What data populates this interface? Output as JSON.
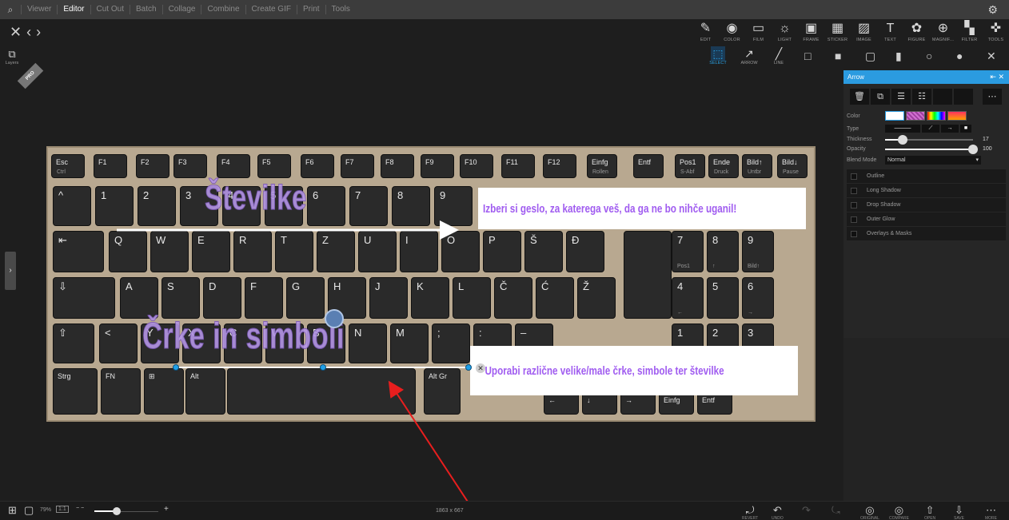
{
  "menu": {
    "items": [
      "Viewer",
      "Editor",
      "Cut Out",
      "Batch",
      "Collage",
      "Combine",
      "Create GIF",
      "Print",
      "Tools"
    ],
    "active": "Editor"
  },
  "nav": {
    "close": "✕",
    "back": "‹",
    "forward": "›"
  },
  "tools": [
    {
      "icon": "edit-icon",
      "glyph": "✎",
      "label": "EDIT"
    },
    {
      "icon": "color-icon",
      "glyph": "◉",
      "label": "COLOR"
    },
    {
      "icon": "film-icon",
      "glyph": "▭",
      "label": "FILM"
    },
    {
      "icon": "light-icon",
      "glyph": "☼",
      "label": "LIGHT"
    },
    {
      "icon": "frame-icon",
      "glyph": "▣",
      "label": "FRAME"
    },
    {
      "icon": "sticker-icon",
      "glyph": "▦",
      "label": "STICKER"
    },
    {
      "icon": "image-icon",
      "glyph": "▨",
      "label": "IMAGE"
    },
    {
      "icon": "text-icon",
      "glyph": "T",
      "label": "TEXT"
    },
    {
      "icon": "figure-icon",
      "glyph": "✿",
      "label": "FIGURE"
    },
    {
      "icon": "magnifier-icon",
      "glyph": "⊕",
      "label": "MAGNIF..."
    },
    {
      "icon": "filter-icon",
      "glyph": "▚",
      "label": "FILTER"
    },
    {
      "icon": "tools-icon",
      "glyph": "✜",
      "label": "TOOLS"
    }
  ],
  "subtools": [
    {
      "icon": "select-icon",
      "glyph": "⬚",
      "label": "SELECT",
      "selected": true
    },
    {
      "icon": "arrow-icon",
      "glyph": "↗",
      "label": "ARROW",
      "selected": false
    },
    {
      "icon": "line-icon",
      "glyph": "╱",
      "label": "LINE",
      "selected": false
    }
  ],
  "shapes": [
    "□",
    "■",
    "▢",
    "▮",
    "○",
    "●",
    "✕"
  ],
  "layers_label": "Layers",
  "pro_badge": "PRO",
  "canvas": {
    "watermark_top": "Številke",
    "watermark_bottom": "Črke in simboli",
    "callout_top": "Izberi si geslo, za katerega veš, da ga ne bo nihče uganil!",
    "callout_bottom": "Uporabi različne velike/male črke, simbole ter številke",
    "keys_row0": [
      {
        "k1": "Esc",
        "k2": "Ctrl"
      },
      {
        "k1": "F1",
        "k2": ""
      },
      {
        "k1": "F2",
        "k2": ""
      },
      {
        "k1": "F3",
        "k2": ""
      },
      {
        "k1": "F4",
        "k2": ""
      },
      {
        "k1": "F5",
        "k2": ""
      },
      {
        "k1": "F6",
        "k2": ""
      },
      {
        "k1": "F7",
        "k2": ""
      },
      {
        "k1": "F8",
        "k2": ""
      },
      {
        "k1": "F9",
        "k2": ""
      },
      {
        "k1": "F10",
        "k2": ""
      },
      {
        "k1": "F11",
        "k2": ""
      },
      {
        "k1": "F12",
        "k2": ""
      },
      {
        "k1": "Einfg",
        "k2": "Rollen"
      },
      {
        "k1": "Entf",
        "k2": ""
      },
      {
        "k1": "Pos1",
        "k2": "S-Abf"
      },
      {
        "k1": "Ende",
        "k2": "Druck"
      },
      {
        "k1": "Bild↑",
        "k2": "Untbr"
      },
      {
        "k1": "Bild↓",
        "k2": "Pause"
      }
    ],
    "keys_row1": [
      "^",
      "1",
      "2",
      "3",
      "4",
      "5",
      "6",
      "7",
      "8",
      "9"
    ],
    "keys_row2": [
      "⇤",
      "Q",
      "W",
      "E",
      "R",
      "T",
      "Z",
      "U",
      "I",
      "O",
      "P",
      "Š",
      "Đ"
    ],
    "keys_row3": [
      "⇩",
      "A",
      "S",
      "D",
      "F",
      "G",
      "H",
      "J",
      "K",
      "L",
      "Č",
      "Ć",
      "Ž"
    ],
    "keys_row4": [
      "⇧",
      "<",
      "Y",
      "X",
      "C",
      "V",
      "B",
      "N",
      "M",
      ";",
      ":",
      "–"
    ],
    "keys_row5": [
      "Strg",
      "FN",
      "⊞",
      "Alt",
      "",
      "Alt Gr"
    ],
    "numpad": [
      [
        "7",
        "Pos1"
      ],
      [
        "8",
        "↑"
      ],
      [
        "9",
        "Bild↑"
      ],
      [
        "4",
        "←"
      ],
      [
        "5",
        ""
      ],
      [
        "6",
        "→"
      ],
      [
        "1",
        ""
      ],
      [
        "2",
        ""
      ],
      [
        "3",
        ""
      ]
    ],
    "bottom_nav": [
      "←",
      "↓",
      "→",
      "Einfg",
      "Entf"
    ]
  },
  "panel": {
    "title": "Arrow",
    "color_label": "Color",
    "type_label": "Type",
    "thickness_label": "Thickness",
    "thickness_value": "17",
    "thickness_fraction": 0.2,
    "opacity_label": "Opacity",
    "opacity_value": "100",
    "opacity_fraction": 1.0,
    "blend_label": "Blend Mode",
    "blend_value": "Normal",
    "effects": [
      "Outline",
      "Long Shadow",
      "Drop Shadow",
      "Outer Glow",
      "Overlays & Masks"
    ],
    "accent": "#2b9be0"
  },
  "bottom": {
    "zoom": "79%",
    "fit": "1:1",
    "zoom_fraction": 0.35,
    "dimensions": "1863 x 667",
    "actions": [
      {
        "icon": "revert-icon",
        "glyph": "⤾",
        "label": "REVERT",
        "dim": false
      },
      {
        "icon": "undo-icon",
        "glyph": "↶",
        "label": "UNDO",
        "dim": false
      },
      {
        "icon": "redo-icon",
        "glyph": "↷",
        "label": "",
        "dim": true
      },
      {
        "icon": "redo-all-icon",
        "glyph": "⤿",
        "label": "",
        "dim": true
      },
      {
        "icon": "original-icon",
        "glyph": "◎",
        "label": "ORIGINAL",
        "dim": false
      },
      {
        "icon": "compare-icon",
        "glyph": "◎",
        "label": "COMPARE",
        "dim": false
      },
      {
        "icon": "open-icon",
        "glyph": "⇧",
        "label": "OPEN",
        "dim": false
      },
      {
        "icon": "save-icon",
        "glyph": "⇩",
        "label": "SAVE",
        "dim": false
      },
      {
        "icon": "more-icon",
        "glyph": "⋯",
        "label": "MORE",
        "dim": false
      }
    ]
  }
}
